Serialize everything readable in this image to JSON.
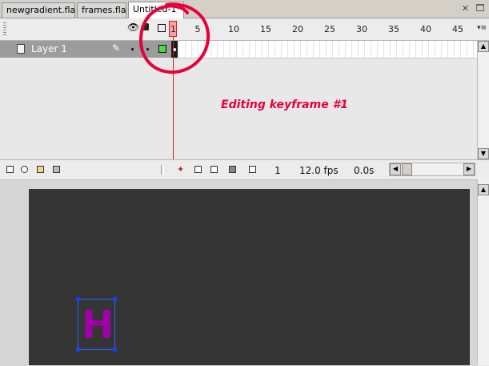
{
  "tabs": [
    {
      "label": "newgradient.fla",
      "active": false
    },
    {
      "label": "frames.fla",
      "active": false
    },
    {
      "label": "Untitled-1*",
      "active": true
    }
  ],
  "window_controls": {
    "close_glyph": "✕"
  },
  "timeline": {
    "frame_numbers": [
      "1",
      "5",
      "10",
      "15",
      "20",
      "25",
      "30",
      "35",
      "40",
      "45"
    ],
    "current_frame_label": "1",
    "panel_menu_glyph": "▾≡",
    "layer": {
      "name": "Layer 1",
      "color": "#44dd44"
    }
  },
  "status": {
    "current_frame": "1",
    "fps": "12.0 fps",
    "elapsed": "0.0s"
  },
  "annotation": "Editing keyframe #1",
  "stage": {
    "letter": "H",
    "letter_color": "#a000a8",
    "background_color": "#353535"
  },
  "colors": {
    "annotation": "#e8003a",
    "playhead": "#cc2222"
  }
}
